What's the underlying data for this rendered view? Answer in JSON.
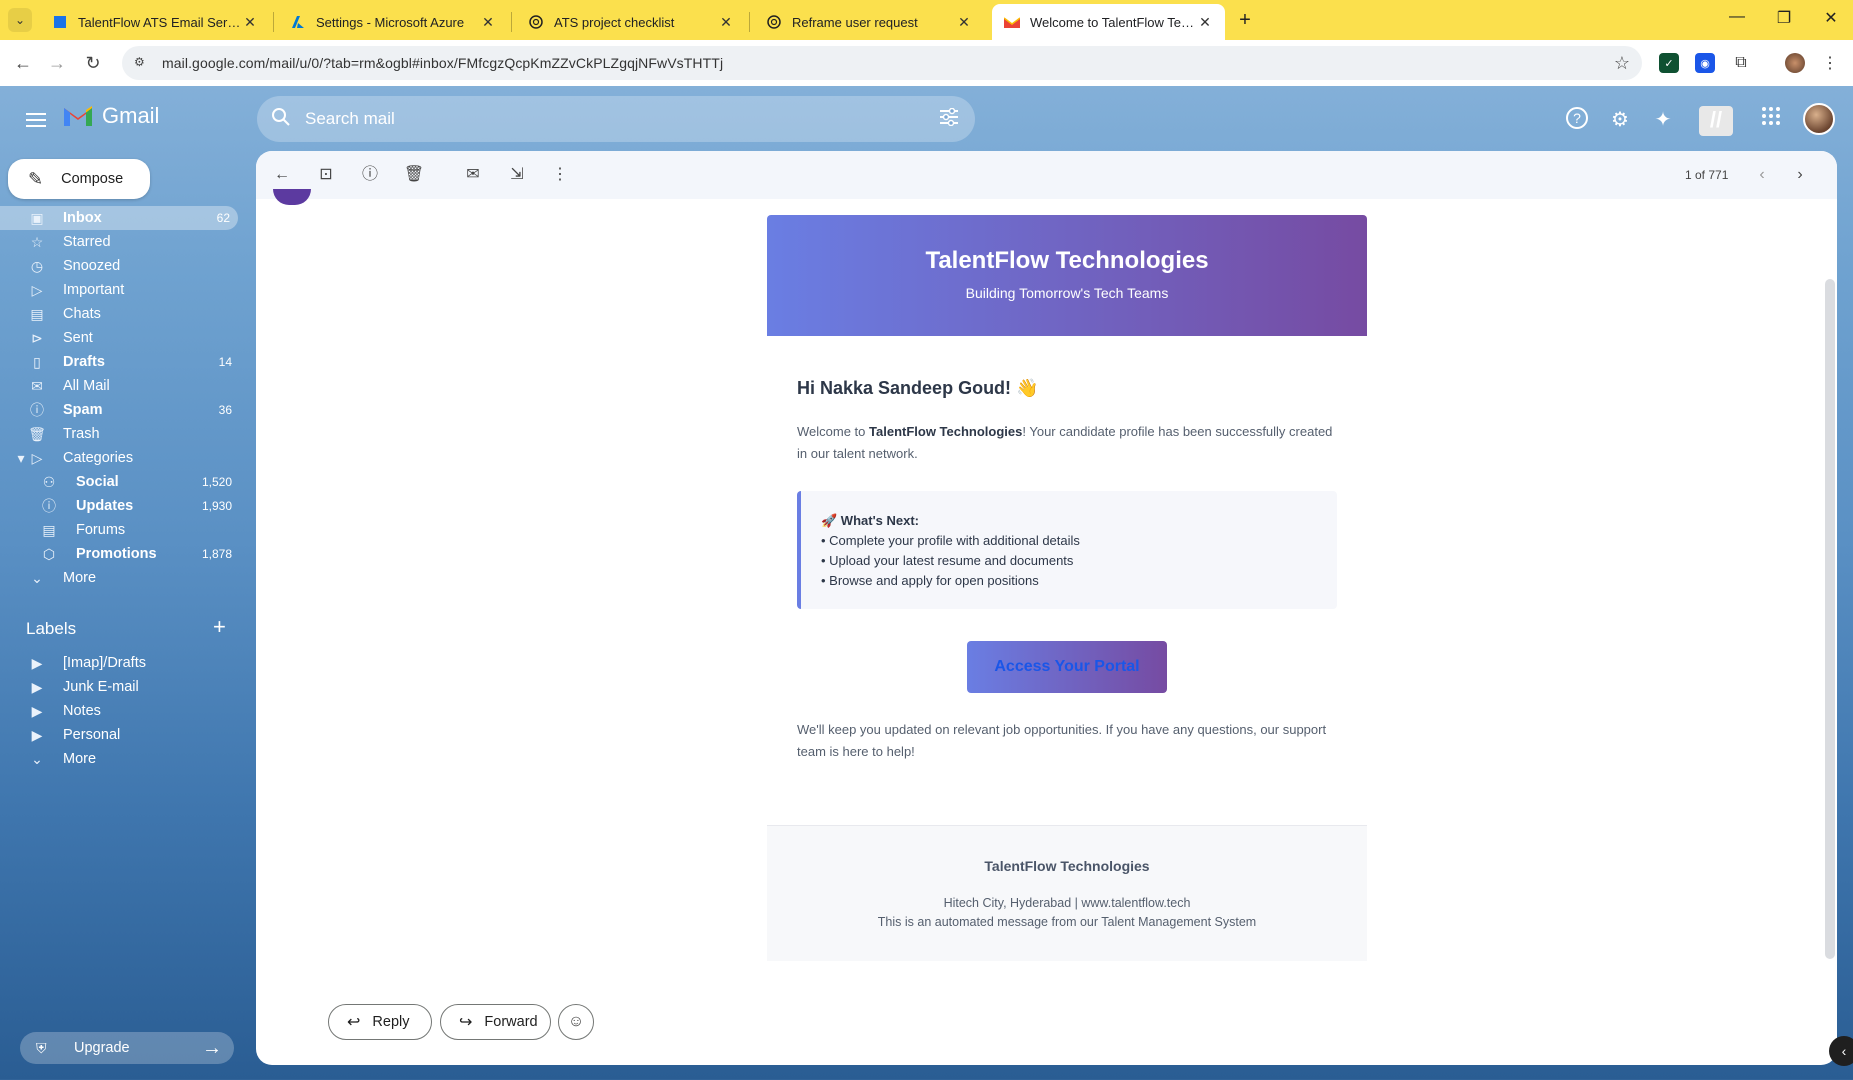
{
  "browser": {
    "tabs": [
      {
        "title": "TalentFlow ATS Email Service - I",
        "favicon": "doc-icon"
      },
      {
        "title": "Settings - Microsoft Azure",
        "favicon": "azure-icon"
      },
      {
        "title": "ATS project checklist",
        "favicon": "chatgpt-icon"
      },
      {
        "title": "Reframe user request",
        "favicon": "chatgpt-icon"
      },
      {
        "title": "Welcome to TalentFlow Technol",
        "favicon": "gmail-icon"
      }
    ],
    "url": "mail.google.com/mail/u/0/?tab=rm&ogbl#inbox/FMfcgzQcpKmZZvCkPLZgqjNFwVsTHTTj"
  },
  "gmail": {
    "logo_text": "Gmail",
    "search_placeholder": "Search mail",
    "compose_label": "Compose",
    "nav": [
      {
        "label": "Inbox",
        "count": "62",
        "icon": "inbox-icon"
      },
      {
        "label": "Starred",
        "count": "",
        "icon": "star-icon"
      },
      {
        "label": "Snoozed",
        "count": "",
        "icon": "clock-icon"
      },
      {
        "label": "Important",
        "count": "",
        "icon": "important-icon"
      },
      {
        "label": "Chats",
        "count": "",
        "icon": "chat-icon"
      },
      {
        "label": "Sent",
        "count": "",
        "icon": "send-icon"
      },
      {
        "label": "Drafts",
        "count": "14",
        "icon": "draft-icon"
      },
      {
        "label": "All Mail",
        "count": "",
        "icon": "all-mail-icon"
      },
      {
        "label": "Spam",
        "count": "36",
        "icon": "spam-icon"
      },
      {
        "label": "Trash",
        "count": "",
        "icon": "trash-icon"
      },
      {
        "label": "Categories",
        "count": "",
        "icon": "label-icon"
      },
      {
        "label": "Social",
        "count": "1,520",
        "icon": "people-icon"
      },
      {
        "label": "Updates",
        "count": "1,930",
        "icon": "info-icon"
      },
      {
        "label": "Forums",
        "count": "",
        "icon": "forum-icon"
      },
      {
        "label": "Promotions",
        "count": "1,878",
        "icon": "tag-icon"
      },
      {
        "label": "More",
        "count": "",
        "icon": "chevron-down-icon"
      }
    ],
    "labels_header": "Labels",
    "labels": [
      {
        "label": "[Imap]/Drafts"
      },
      {
        "label": "Junk E-mail"
      },
      {
        "label": "Notes"
      },
      {
        "label": "Personal"
      },
      {
        "label": "More"
      }
    ],
    "upgrade_label": "Upgrade",
    "page_info": "1 of 771"
  },
  "email": {
    "company": "TalentFlow Technologies",
    "tagline": "Building Tomorrow's Tech Teams",
    "greeting": "Hi Nakka Sandeep Goud! 👋",
    "intro_prefix": "Welcome to ",
    "intro_company": "TalentFlow Technologies",
    "intro_suffix": "! Your candidate profile has been successfully created in our talent network.",
    "next_title": "🚀 What's Next:",
    "next_items": [
      "• Complete your profile with additional details",
      "• Upload your latest resume and documents",
      "• Browse and apply for open positions"
    ],
    "cta_label": "Access Your Portal",
    "closing": "We'll keep you updated on relevant job opportunities. If you have any questions, our support team is here to help!",
    "footer_company": "TalentFlow Technologies",
    "footer_address": "Hitech City, Hyderabad | www.talentflow.tech",
    "footer_note": "This is an automated message from our Talent Management System"
  },
  "actions": {
    "reply": "Reply",
    "forward": "Forward"
  }
}
